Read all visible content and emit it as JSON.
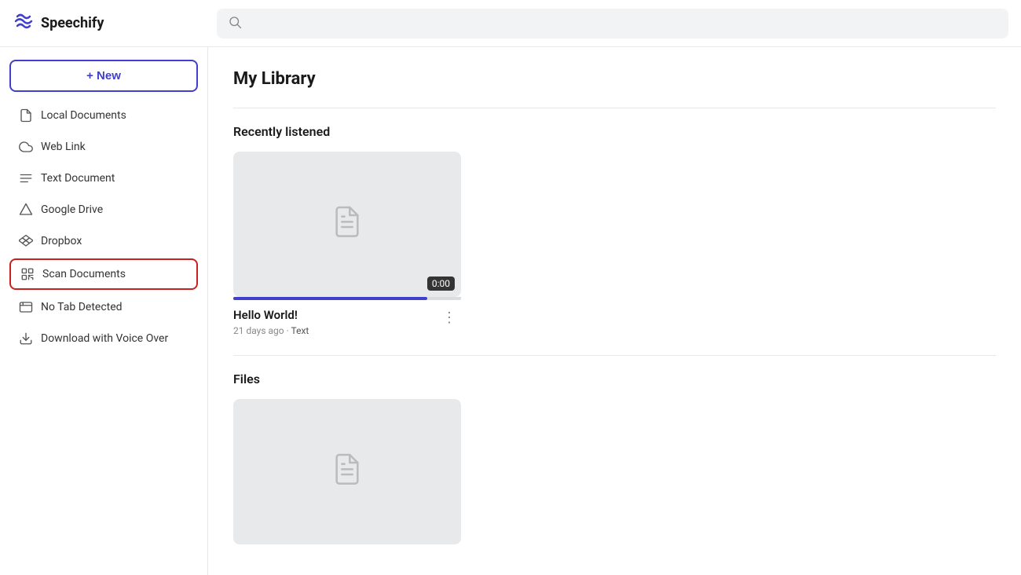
{
  "header": {
    "logo_text": "Speechify",
    "search_placeholder": ""
  },
  "sidebar": {
    "new_button_label": "+ New",
    "items": [
      {
        "id": "local-documents",
        "label": "Local Documents",
        "icon": "file"
      },
      {
        "id": "web-link",
        "label": "Web Link",
        "icon": "cloud"
      },
      {
        "id": "text-document",
        "label": "Text Document",
        "icon": "lines"
      },
      {
        "id": "google-drive",
        "label": "Google Drive",
        "icon": "triangle"
      },
      {
        "id": "dropbox",
        "label": "Dropbox",
        "icon": "dropbox"
      },
      {
        "id": "scan-documents",
        "label": "Scan Documents",
        "icon": "scan",
        "highlighted": true
      },
      {
        "id": "no-tab-detected",
        "label": "No Tab Detected",
        "icon": "tab"
      },
      {
        "id": "download-voice-over",
        "label": "Download with Voice Over",
        "icon": "download"
      }
    ]
  },
  "main": {
    "title": "My Library",
    "recently_listened_section": "Recently listened",
    "files_section": "Files",
    "cards": [
      {
        "id": "hello-world",
        "title": "Hello World!",
        "meta_time": "21 days ago",
        "meta_sep": "·",
        "meta_type": "Text",
        "time_badge": "0:00",
        "progress": 85
      }
    ]
  }
}
